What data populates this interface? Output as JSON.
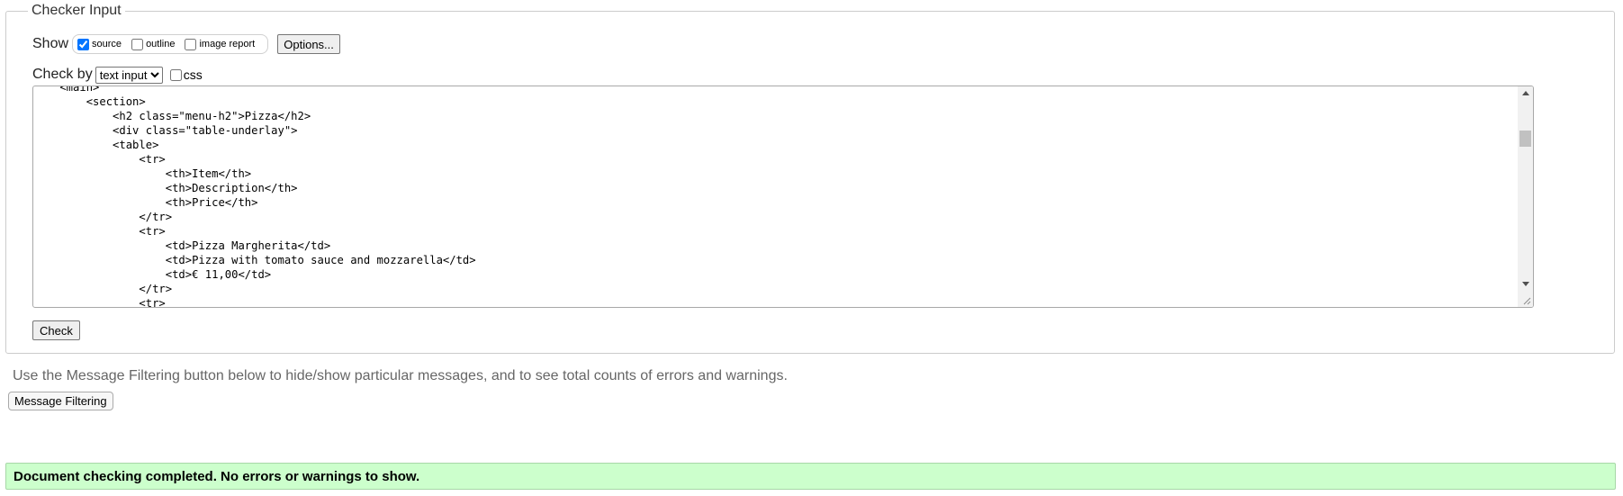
{
  "fieldset": {
    "legend": "Checker Input"
  },
  "show": {
    "label": "Show",
    "options": [
      {
        "label": "source",
        "checked": true
      },
      {
        "label": "outline",
        "checked": false
      },
      {
        "label": "image report",
        "checked": false
      }
    ],
    "options_button": "Options..."
  },
  "check_by": {
    "label": "Check by",
    "selected": "text input",
    "css_label": "css",
    "css_checked": false
  },
  "source_lines": [
    "    <main>",
    "        <section>",
    "            <h2 class=\"menu-h2\">Pizza</h2>",
    "            <div class=\"table-underlay\">",
    "            <table>",
    "                <tr>",
    "                    <th>Item</th>",
    "                    <th>Description</th>",
    "                    <th>Price</th>",
    "                </tr>",
    "                <tr>",
    "                    <td>Pizza Margherita</td>",
    "                    <td>Pizza with tomato sauce and mozzarella</td>",
    "                    <td>€ 11,00</td>",
    "                </tr>",
    "                <tr>"
  ],
  "check_button": "Check",
  "info_text": "Use the Message Filtering button below to hide/show particular messages, and to see total counts of errors and warnings.",
  "filter_button": "Message Filtering",
  "result_message": "Document checking completed. No errors or warnings to show.",
  "colors": {
    "success_bg": "#ccffcc",
    "success_border": "#a7d7a7",
    "info_text": "#666666"
  }
}
